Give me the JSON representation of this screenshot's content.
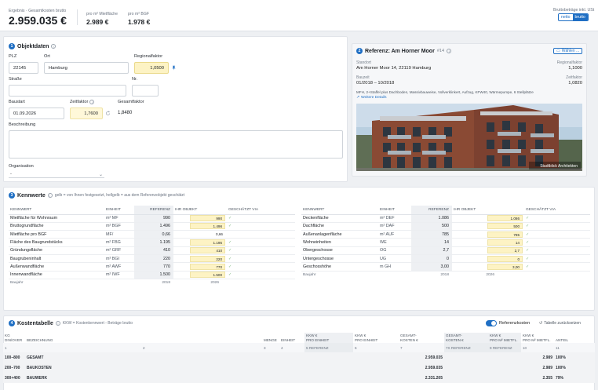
{
  "header": {
    "label_total": "Ergebnis · Gesamtkosten brutto",
    "total": "2.959.035 €",
    "label_per_mf": "pro m² Mietfläche",
    "per_mf": "2.989 €",
    "label_per_bgf": "pro m² BGF",
    "per_bgf": "1.978 €",
    "toggle_label": "Bruttobeträge inkl. USt",
    "toggle_netto": "netto",
    "toggle_brutto": "brutto"
  },
  "objekt": {
    "num": "1",
    "title": "Objektdaten",
    "plz_label": "PLZ",
    "plz": "22145",
    "ort_label": "Ort",
    "ort": "Hamburg",
    "regional_label": "Regionalfaktor",
    "regional": "1,0500",
    "strasse_label": "Straße",
    "strasse": "",
    "nr_label": "Nr.",
    "nr": "",
    "baustart_label": "Baustart",
    "baustart": "01.09.2026",
    "zeit_label": "Zeitfaktor",
    "zeit": "1,7600",
    "gesamt_label": "Gesamtfaktor",
    "gesamt": "1,8480",
    "beschreibung_label": "Beschreibung",
    "beschreibung": "",
    "organisation_label": "Organisation",
    "organisation": "-"
  },
  "referenz": {
    "num": "2",
    "title": "Referenz: Am Horner Moor",
    "id": "#14",
    "waehlen": "Wählen ...",
    "standort_label": "Standort",
    "standort": "Am Horner Moor 14, 22119 Hamburg",
    "regional_label": "Regionalfaktor",
    "regional": "1,1000",
    "bauzeit_label": "Bauzeit",
    "bauzeit": "01/2018 – 10/2018",
    "zeit_label": "Zeitfaktor",
    "zeit": "1,0820",
    "desc": "MFH, 2+Staffel plus Dachboden, Massivbauweise, Vollverklinkert, Aufzug, KFW40, Wärmepumpe, 6 Stellplätze",
    "details": "Weitere Details",
    "photo_caption": "Stadtblick Architekten"
  },
  "kennwerte": {
    "num": "3",
    "title": "Kennwerte",
    "hint": "gelb = von Ihnen festgesetzt, hellgelb = aus dem Referenzobjekt geschätzt",
    "cols": [
      "KENNWERT",
      "EINHEIT",
      "REFERENZ",
      "IHR OBJEKT",
      "GESCHÄTZT VIA"
    ],
    "left": [
      {
        "name": "Mietfläche für Wohnraum",
        "unit": "m² MF",
        "ref": "990",
        "obj": "990",
        "est": true
      },
      {
        "name": "Bruttogrundfläche",
        "unit": "m² BGF",
        "ref": "1.496",
        "obj": "1.496",
        "est": true
      },
      {
        "name": "Mietfläche pro BGF",
        "unit": "MF/",
        "ref": "0,66",
        "obj": "0,66",
        "est": false
      },
      {
        "name": "Fläche des Baugrundstücks",
        "unit": "m² FBG",
        "ref": "1.195",
        "obj": "1.195",
        "est": true
      },
      {
        "name": "Gründungsfläche",
        "unit": "m² GRF",
        "ref": "410",
        "obj": "410",
        "est": true
      },
      {
        "name": "Baugrubeninhalt",
        "unit": "m³ BGI",
        "ref": "220",
        "obj": "220",
        "est": true
      },
      {
        "name": "Außenwandfläche",
        "unit": "m² AWF",
        "ref": "770",
        "obj": "770",
        "est": true
      },
      {
        "name": "Innenwandfläche",
        "unit": "m² IWF",
        "ref": "1.500",
        "obj": "1.500",
        "est": true
      }
    ],
    "right": [
      {
        "name": "Deckenfläche",
        "unit": "m² DEF",
        "ref": "1.086",
        "obj": "1.086",
        "est": true
      },
      {
        "name": "Dachfläche",
        "unit": "m² DAF",
        "ref": "500",
        "obj": "500",
        "est": true
      },
      {
        "name": "Außenanlagenfläche",
        "unit": "m² AUF",
        "ref": "785",
        "obj": "785",
        "est": true
      },
      {
        "name": "Wohneinheiten",
        "unit": "WE",
        "ref": "14",
        "obj": "14",
        "est": true
      },
      {
        "name": "Obergeschosse",
        "unit": "OG",
        "ref": "2,7",
        "obj": "2,7",
        "est": true
      },
      {
        "name": "Untergeschosse",
        "unit": "UG",
        "ref": "0",
        "obj": "0",
        "est": true
      },
      {
        "name": "Geschosshöhe",
        "unit": "m GH",
        "ref": "3,00",
        "obj": "3,00",
        "est": true
      }
    ],
    "baujahr_label": "Baujahr",
    "baujahr_ref": "2018",
    "baujahr_obj": "2026"
  },
  "kosten": {
    "num": "4",
    "title": "Kostentabelle",
    "hint": "KKW = Kostenkennwert - Beträge brutto",
    "ref_toggle": "Referenzkosten",
    "reset": "Tabelle zurücksetzen",
    "header": {
      "kg": "KG",
      "kg_sub": "DIN/OVER",
      "bez": "BEZEICHNUNG",
      "menge": "MENGE",
      "einheit": "EINHEIT",
      "kkw1": "KKW €",
      "kkw1_sub": "PRO EINHEIT",
      "kkw2": "KKW €",
      "kkw2_sub": "PRO EINHEIT",
      "gk1": "GESAMT-",
      "gk1_sub": "KOSTEN €",
      "gk2": "GESAMT-",
      "gk2_sub": "KOSTEN €",
      "kkw3": "KKW €",
      "kkw3_sub": "PRO M² MIETFL.",
      "kkw4": "KKW €",
      "kkw4_sub": "PRO M² MIETFL.",
      "anteil": "ANTEIL"
    },
    "numrow": [
      "1",
      "2",
      "3",
      "4",
      "5 REFERENZ",
      "6",
      "7",
      "7X REFERENZ",
      "9 REFERENZ",
      "10",
      "11"
    ],
    "rows": [
      {
        "kg": "100–800",
        "name": "GESAMT",
        "gk": "2.959.035",
        "kkw": "2.989",
        "anteil": "100%"
      },
      {
        "kg": "200–700",
        "name": "BAUKOSTEN",
        "gk": "2.959.035",
        "kkw": "2.989",
        "anteil": "100%"
      },
      {
        "kg": "300+400",
        "name": "BAUWERK",
        "gk": "2.331.205",
        "kkw": "2.355",
        "anteil": "79%"
      }
    ]
  }
}
